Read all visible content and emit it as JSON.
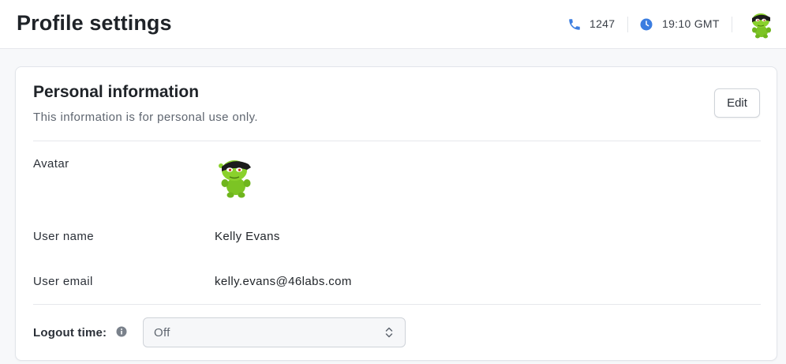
{
  "header": {
    "title": "Profile settings",
    "extension": "1247",
    "time": "19:10 GMT",
    "icons": {
      "phone": "phone-icon",
      "clock": "clock-icon",
      "avatar": "user-avatar"
    }
  },
  "personal_info": {
    "title": "Personal information",
    "subtitle": "This information is for personal use only.",
    "edit_label": "Edit",
    "avatar_label": "Avatar",
    "username_label": "User name",
    "username_value": "Kelly Evans",
    "email_label": "User email",
    "email_value": "kelly.evans@46labs.com",
    "logout_label": "Logout time:",
    "logout_value": "Off"
  },
  "colors": {
    "accent_icon": "#3b7de0",
    "page_bg": "#f7f8fa",
    "card_bg": "#ffffff",
    "avatar_green": "#7cc424"
  }
}
